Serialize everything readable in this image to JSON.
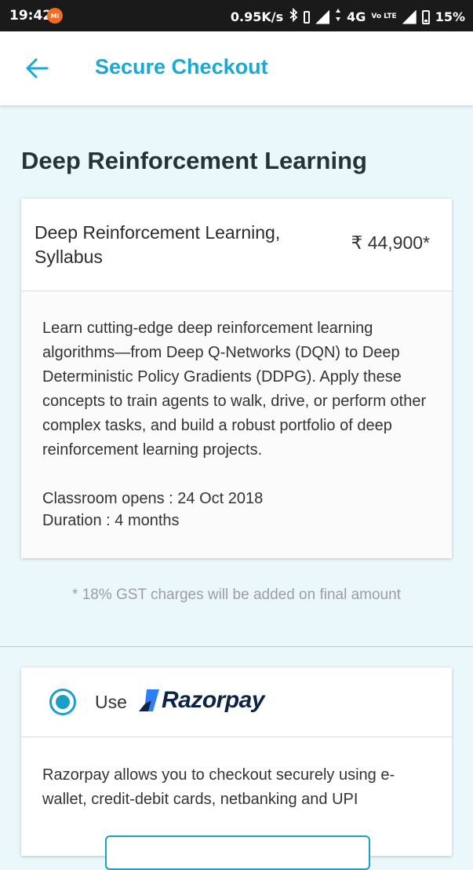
{
  "status_bar": {
    "time": "19:42",
    "notification_badge": "Mi",
    "speed": "0.95K/s",
    "network": "4G",
    "volte": "Vo LTE",
    "battery": "15%"
  },
  "header": {
    "title": "Secure Checkout",
    "accent_color": "#18a9d4"
  },
  "course": {
    "heading": "Deep Reinforcement Learning",
    "product_name": "Deep Reinforcement Learning, Syllabus",
    "price": "₹ 44,900*",
    "description": "Learn cutting-edge deep reinforcement learning algorithms—from Deep Q-Networks (DQN) to Deep Deterministic Policy Gradients (DDPG). Apply these concepts to train agents to walk, drive, or perform other complex tasks, and build a robust portfolio of deep reinforcement learning projects.",
    "classroom_opens": "Classroom opens : 24 Oct 2018",
    "duration": "Duration : 4 months"
  },
  "gst_note": "* 18% GST charges will be added on final amount",
  "payment": {
    "use_label": "Use",
    "provider_name": "Razorpay",
    "description": "Razorpay allows you to checkout securely using e-wallet, credit-debit cards, netbanking and UPI",
    "selected": true
  }
}
